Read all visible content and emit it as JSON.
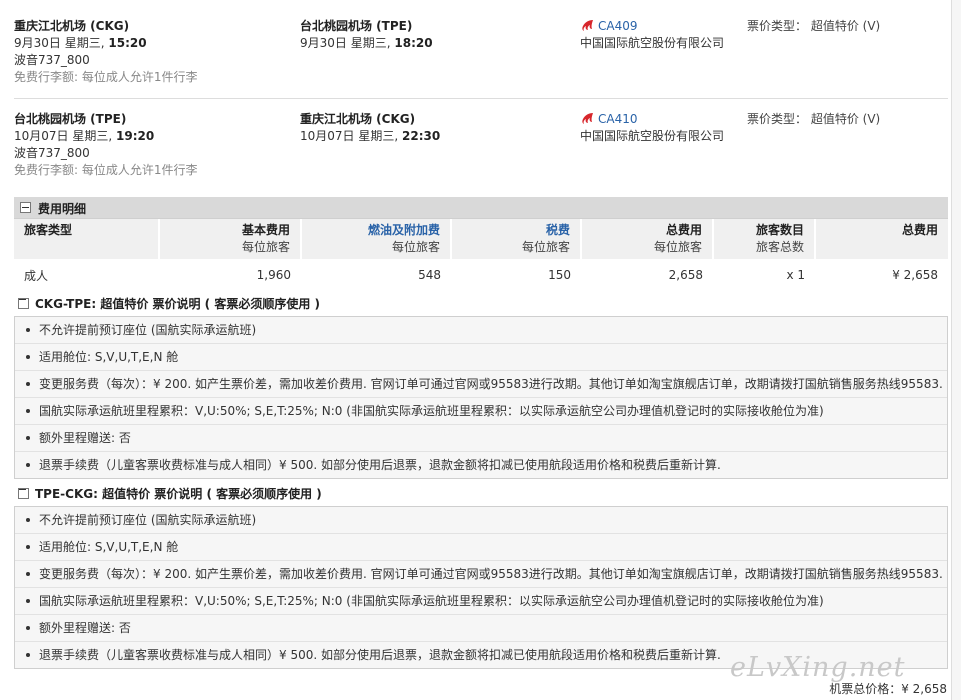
{
  "flights": [
    {
      "dep_airport": "重庆江北机场 (CKG)",
      "dep_date": "9月30日 星期三,",
      "dep_time": "15:20",
      "aircraft": "波音737_800",
      "baggage": "免费行李额: 每位成人允许1件行李",
      "arr_airport": "台北桃园机场 (TPE)",
      "arr_date": "9月30日 星期三,",
      "arr_time": "18:20",
      "flight_no": "CA409",
      "airline": "中国国际航空股份有限公司",
      "fare_label": "票价类型：",
      "fare_type": "超值特价 (V)"
    },
    {
      "dep_airport": "台北桃园机场 (TPE)",
      "dep_date": "10月07日 星期三,",
      "dep_time": "19:20",
      "aircraft": "波音737_800",
      "baggage": "免费行李额: 每位成人允许1件行李",
      "arr_airport": "重庆江北机场 (CKG)",
      "arr_date": "10月07日 星期三,",
      "arr_time": "22:30",
      "flight_no": "CA410",
      "airline": "中国国际航空股份有限公司",
      "fare_label": "票价类型：",
      "fare_type": "超值特价 (V)"
    }
  ],
  "fees": {
    "title": "费用明细",
    "headers": [
      {
        "h1": "旅客类型",
        "h2": ""
      },
      {
        "h1": "基本费用",
        "h2": "每位旅客"
      },
      {
        "h1": "燃油及附加费",
        "h2": "每位旅客"
      },
      {
        "h1": "税费",
        "h2": "每位旅客"
      },
      {
        "h1": "总费用",
        "h2": "每位旅客"
      },
      {
        "h1": "旅客数目",
        "h2": "旅客总数"
      },
      {
        "h1": "总费用",
        "h2": ""
      }
    ],
    "row": [
      "成人",
      "1,960",
      "548",
      "150",
      "2,658",
      "x 1",
      "¥ 2,658"
    ]
  },
  "rules": [
    {
      "title": "CKG-TPE: 超值特价 票价说明 ( 客票必须顺序使用 )",
      "items": [
        "不允许提前预订座位 (国航实际承运航班)",
        "适用舱位: S,V,U,T,E,N 舱",
        "变更服务费（每次）：¥ 200. 如产生票价差，需加收差价费用. 官网订单可通过官网或95583进行改期。其他订单如淘宝旗舰店订单，改期请拨打国航销售服务热线95583.",
        "国航实际承运航班里程累积：V,U:50%; S,E,T:25%; N:0 (非国航实际承运航班里程累积：以实际承运航空公司办理值机登记时的实际接收舱位为准)",
        "额外里程赠送: 否",
        "退票手续费（儿童客票收费标准与成人相同）¥ 500. 如部分使用后退票，退款金额将扣减已使用航段适用价格和税费后重新计算."
      ]
    },
    {
      "title": "TPE-CKG: 超值特价 票价说明 ( 客票必须顺序使用 )",
      "items": [
        "不允许提前预订座位 (国航实际承运航班)",
        "适用舱位: S,V,U,T,E,N 舱",
        "变更服务费（每次）：¥ 200. 如产生票价差，需加收差价费用. 官网订单可通过官网或95583进行改期。其他订单如淘宝旗舰店订单，改期请拨打国航销售服务热线95583.",
        "国航实际承运航班里程累积：V,U:50%; S,E,T:25%; N:0 (非国航实际承运航班里程累积：以实际承运航空公司办理值机登记时的实际接收舱位为准)",
        "额外里程赠送: 否",
        "退票手续费（儿童客票收费标准与成人相同）¥ 500. 如部分使用后退票，退款金额将扣减已使用航段适用价格和税费后重新计算."
      ]
    }
  ],
  "watermark": "eLvXing.net",
  "total": "机票总价格：¥ 2,658",
  "colors": {
    "link": "#2a63a8",
    "airline_logo": "#d7262b"
  },
  "icons": {
    "airline": "air-china-logo-icon",
    "collapse": "collapse-minus-icon",
    "bullet": "bullet-icon"
  }
}
